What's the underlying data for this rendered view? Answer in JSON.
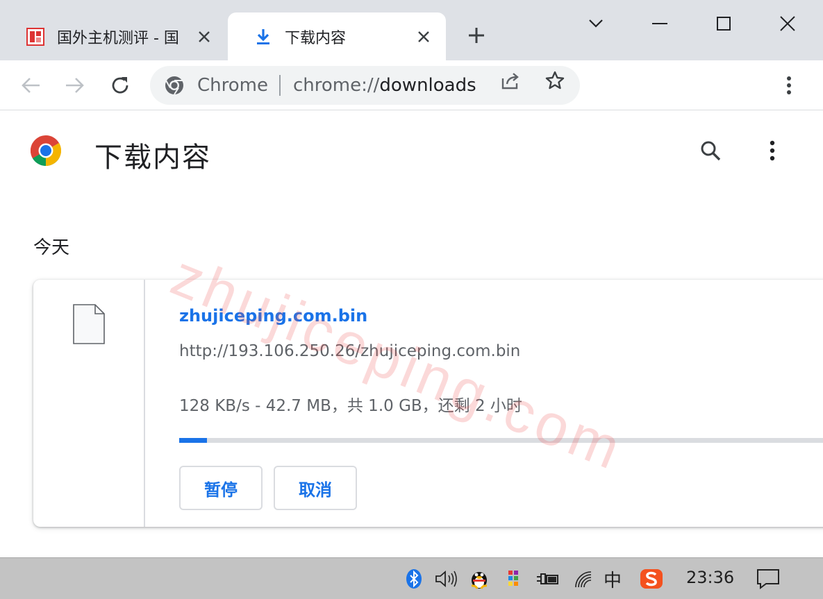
{
  "tabs": [
    {
      "title": "国外主机测评 - 国",
      "active": false
    },
    {
      "title": "下载内容",
      "active": true
    }
  ],
  "toolbar": {
    "origin": "Chrome",
    "url_scheme": "chrome://",
    "url_path": "downloads"
  },
  "page": {
    "title": "下载内容",
    "date_group": "今天"
  },
  "download": {
    "file_name": "zhujiceping.com.bin",
    "url": "http://193.106.250.26/zhujiceping.com.bin",
    "status": "128 KB/s - 42.7 MB，共 1.0 GB，还剩 2 小时",
    "progress_percent": 4.2,
    "pause_label": "暂停",
    "cancel_label": "取消"
  },
  "watermark": "zhujiceping.com",
  "taskbar": {
    "ime": "中",
    "time": "23:36"
  },
  "colors": {
    "accent": "#1a73e8",
    "tabstrip": "#dee1e6",
    "taskbar": "#c3c3c3"
  }
}
